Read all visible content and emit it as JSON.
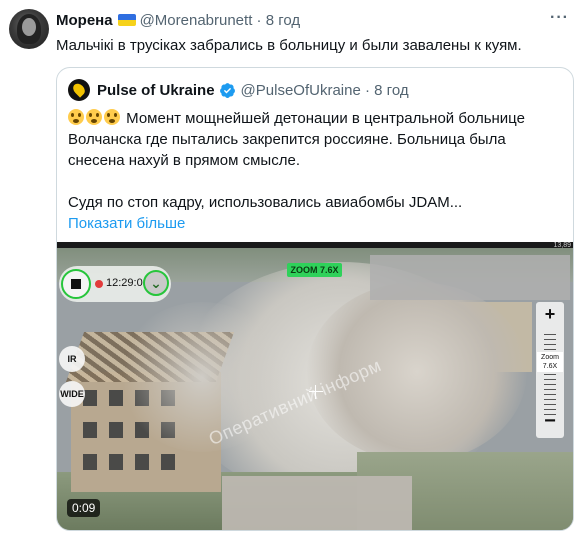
{
  "tweet": {
    "author_name": "Морена",
    "author_handle": "@Morenabrunett",
    "time": "8 год",
    "text": "Мальчiкi в трусiках забрались в больницу и были завалены к куям.",
    "more_icon": "ellipsis-icon"
  },
  "quote": {
    "author_name": "Pulse of Ukraine",
    "author_handle": "@PulseOfUkraine",
    "time": "8 год",
    "line1": "Момент мощнейшей детонации в центральной больнице",
    "line2": "Волчанска где пытались закрепится россияне. Больница была",
    "line3": "снесена нахуй в прямом смысле.",
    "line4": "Судя по стоп кадру, использовались авиабомбы JDAM...",
    "show_more": "Показати більше"
  },
  "video": {
    "rec_time": "12:29:03",
    "zoom_badge": "ZOOM 7.6X",
    "zoom_label_1": "Zoom",
    "zoom_label_2": "7.6X",
    "watermark": "Оперативний інформ",
    "btn_ir": "IR",
    "btn_wide": "WIDE",
    "top_num": "13,89",
    "duration": "0:09"
  },
  "colors": {
    "link": "#1d9bf0",
    "secondary_text": "#536471",
    "verified": "#1d9bf0",
    "rec": "#e23b3b",
    "hud_green": "#2fd15a"
  }
}
